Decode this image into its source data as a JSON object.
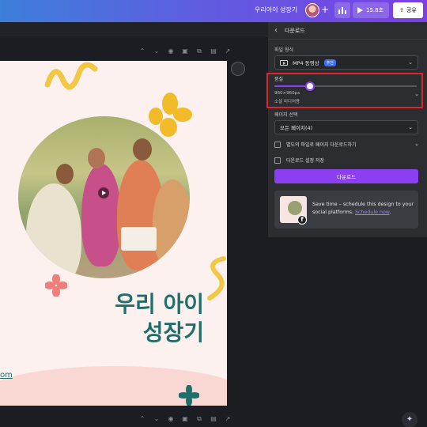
{
  "topbar": {
    "title": "우리아이 성장기",
    "play_time": "15.8초",
    "share_label": "공유"
  },
  "canvas": {
    "headline_line1": "우리 아이",
    "headline_line2": "성장기",
    "partial_link": "om"
  },
  "panel": {
    "header": "다운로드",
    "file_type_label": "파일 형식",
    "file_type_value": "MP4 동영상",
    "file_type_badge": "추천",
    "quality_label": "품질",
    "quality_fraction": 0.25,
    "quality_resolution": "960×960px",
    "quality_note": "소셜 미디어용",
    "page_select_label": "페이지 선택",
    "page_select_value": "모든 페이지(4)",
    "separate_files_label": "별도의 파일로 페이지 다운로드하기",
    "save_settings_label": "다운로드 설정 저장",
    "download_button": "다운로드",
    "promo_text": "Save time – schedule this design to your social platforms.",
    "promo_link": "Schedule now",
    "promo_period": "."
  },
  "colors": {
    "accent": "#8b3ff0",
    "headline": "#1f6e6a",
    "highlight": "#e0262b"
  },
  "icons": [
    "chevron-left-icon",
    "video-icon",
    "chevron-down-icon",
    "play-icon",
    "share-icon",
    "analytics-icon",
    "facebook-icon",
    "magic-icon"
  ]
}
